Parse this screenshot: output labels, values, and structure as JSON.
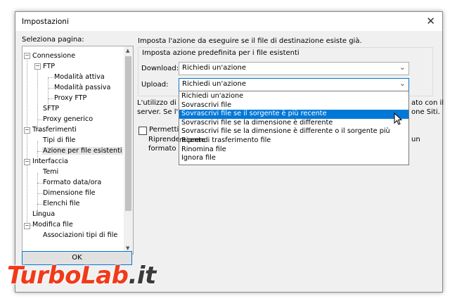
{
  "window": {
    "title": "Impostazioni",
    "close_glyph": "✕"
  },
  "left": {
    "label": "Seleziona pagina:",
    "tree": [
      {
        "label": "Connessione",
        "expander": "−"
      },
      {
        "label": "FTP",
        "expander": "−"
      },
      {
        "label": "Modalità attiva"
      },
      {
        "label": "Modalità passiva"
      },
      {
        "label": "Proxy FTP"
      },
      {
        "label": "SFTP"
      },
      {
        "label": "Proxy generico"
      },
      {
        "label": "Trasferimenti",
        "expander": "−"
      },
      {
        "label": "Tipi di file"
      },
      {
        "label": "Azione per file esistenti",
        "selected": true
      },
      {
        "label": "Interfaccia",
        "expander": "−"
      },
      {
        "label": "Temi"
      },
      {
        "label": "Formato data/ora"
      },
      {
        "label": "Dimensione file"
      },
      {
        "label": "Elenchi file"
      },
      {
        "label": "Lingua"
      },
      {
        "label": "Modifica file",
        "expander": "−"
      },
      {
        "label": "Associazioni tipi di file"
      }
    ],
    "ok_label": "OK"
  },
  "right": {
    "header": "Imposta l'azione da eseguire se il file di destinazione esiste già.",
    "group_title": "Imposta azione predefinita per i file esistenti",
    "download": {
      "label": "Download:",
      "value": "Richiedi un'azione"
    },
    "upload": {
      "label": "Upload:",
      "value": "Richiedi un'azione"
    },
    "info_line1_left": "L'utilizzo di 'S",
    "info_line1_right": "ato con il",
    "info_line2_left": "server. Se l'or",
    "info_line2_right": "one Siti.",
    "permit_label": "Permetti il",
    "desc_line1_left": "Riprender",
    "desc_line1_right": "un",
    "desc_line2_left": "formato d",
    "options": [
      "Richiedi un'azione",
      "Sovrascrivi file",
      "Sovrascrivi file se il sorgente è più recente",
      "Sovrascrivi file se la dimensione è differente",
      "Sovrascrivi file se la dimensione è differente o il sorgente più recente",
      "Riprendi trasferimento file",
      "Rinomina file",
      "Ignora file"
    ],
    "highlighted_index": 2
  },
  "watermark": {
    "part1": "TurboLab",
    "part2": ".it",
    "colors": {
      "red": "#f13a1a",
      "dark": "#3a3a3a"
    }
  }
}
